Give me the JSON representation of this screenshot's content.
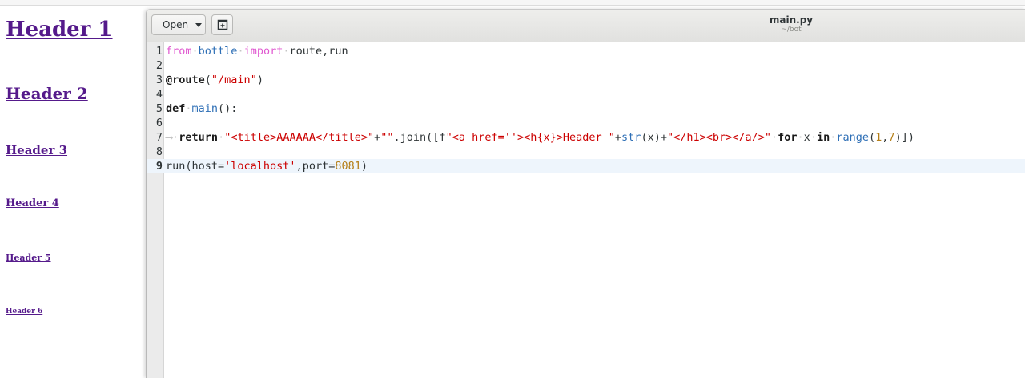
{
  "page": {
    "headers": [
      "Header 1",
      "Header 2",
      "Header 3",
      "Header 4",
      "Header 5",
      "Header 6"
    ]
  },
  "editor": {
    "open_label": "Open",
    "file_name": "main.py",
    "file_path": "~/bot",
    "line_numbers": [
      "1",
      "2",
      "3",
      "4",
      "5",
      "6",
      "7",
      "8",
      "9"
    ],
    "code": {
      "l1": {
        "kw1": "from",
        "mod": "bottle",
        "kw2": "import",
        "rest": "route,run"
      },
      "l3": {
        "decorator": "@route",
        "open": "(",
        "str": "\"/main\"",
        "close": ")"
      },
      "l5": {
        "kw": "def",
        "fn": "main",
        "rest": "():"
      },
      "l7": {
        "indent": "⟶",
        "kw": "return",
        "s1": "\"<title>AAAAAA</title>\"",
        "p1": "+",
        "s2": "\"\"",
        "p2": ".join([f",
        "s3": "\"<a href=''><h{x}>Header \"",
        "p3": "+",
        "fn": "str",
        "p4": "(x)+",
        "s4": "\"</h1><br></a/>\"",
        "kw2": "for",
        "p5": "x",
        "kw3": "in",
        "fn2": "range",
        "p6": "(",
        "n1": "1",
        "p7": ",",
        "n2": "7",
        "p8": ")])"
      },
      "l9": {
        "p1": "run(host=",
        "str": "'localhost'",
        "p2": ",port=",
        "num": "8081",
        "p3": ")"
      }
    }
  },
  "colors": {
    "link": "#551a8b",
    "keyword_pink": "#e058d0",
    "name_blue": "#2e6fb6",
    "string_red": "#cc0000",
    "number": "#b6801a",
    "current_line": "#eef5fc"
  }
}
